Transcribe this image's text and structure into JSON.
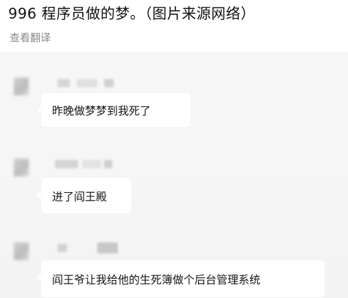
{
  "post": {
    "title": "996 程序员做的梦。（图片来源网络）",
    "translate_label": "查看翻译"
  },
  "chat": {
    "messages": [
      {
        "text": "昨晚做梦梦到我死了"
      },
      {
        "text": "进了阎王殿"
      },
      {
        "text": "阎王爷让我给他的生死簿做个后台管理系统"
      }
    ]
  },
  "colors": {
    "photo_background": "#f5f5f5",
    "bubble_background": "#ffffff",
    "secondary_text": "#8a8a8a"
  }
}
